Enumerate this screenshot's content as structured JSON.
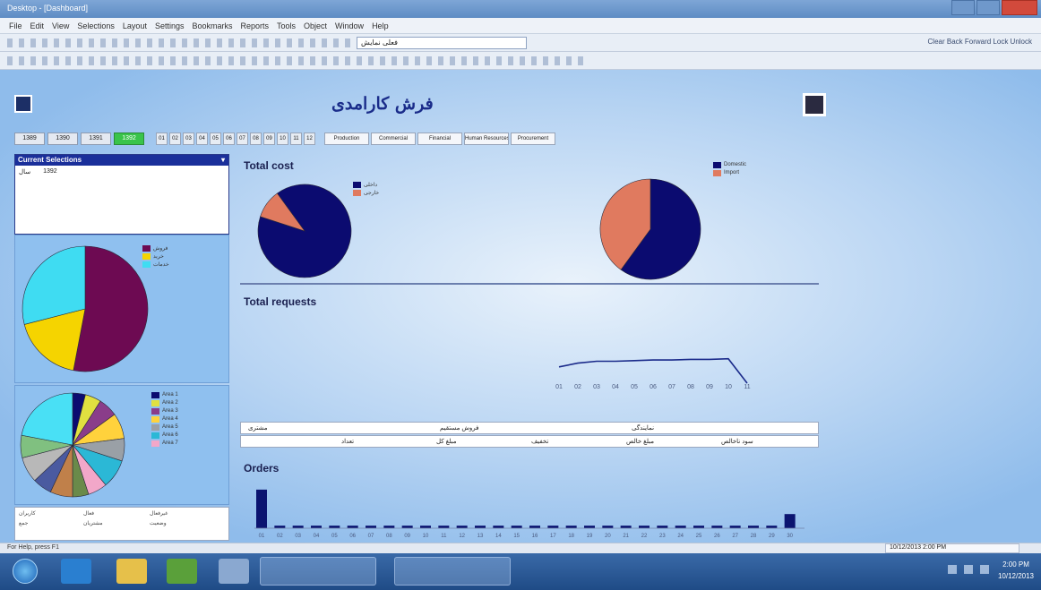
{
  "window": {
    "title": "Desktop - [Dashboard]"
  },
  "menu": [
    "File",
    "Edit",
    "View",
    "Selections",
    "Layout",
    "Settings",
    "Bookmarks",
    "Reports",
    "Tools",
    "Object",
    "Window",
    "Help"
  ],
  "toolbar": {
    "combo_value": "فعلی نمایش",
    "right_items": "Clear  Back  Forward  Lock  Unlock"
  },
  "header": {
    "title": "فرش کارامدی"
  },
  "filters": {
    "years": [
      {
        "label": "1389",
        "active": false
      },
      {
        "label": "1390",
        "active": false
      },
      {
        "label": "1391",
        "active": false
      },
      {
        "label": "1392",
        "active": true
      }
    ],
    "months": [
      "01",
      "02",
      "03",
      "04",
      "05",
      "06",
      "07",
      "08",
      "09",
      "10",
      "11",
      "12"
    ],
    "units": [
      "Production",
      "Commercial",
      "Financial",
      "Human Resources",
      "Procurement"
    ]
  },
  "current_selections": {
    "header": "Current Selections",
    "field": "سال",
    "value": "1392"
  },
  "left_legend_1": [
    {
      "label": "فروش",
      "color": "#6d0a52"
    },
    {
      "label": "خرید",
      "color": "#f5d400"
    },
    {
      "label": "خدمات",
      "color": "#3fdcf2"
    }
  ],
  "left_legend_2": [
    {
      "label": "Area 1",
      "color": "#0b0b70"
    },
    {
      "label": "Area 2",
      "color": "#e0e040"
    },
    {
      "label": "Area 3",
      "color": "#8a3d8a"
    },
    {
      "label": "Area 4",
      "color": "#ffd23c"
    },
    {
      "label": "Area 5",
      "color": "#9aa0a6"
    },
    {
      "label": "Area 6",
      "color": "#2bb8d6"
    },
    {
      "label": "Area 7",
      "color": "#f2a7c9"
    }
  ],
  "bottom_box_labels": [
    "کاربران",
    "فعال",
    "غیرفعال",
    "جمع",
    "مشتریان",
    "وضعیت"
  ],
  "sections": {
    "total_cost": "Total cost",
    "total_requests": "Total requests",
    "orders": "Orders"
  },
  "cost_legend_1": [
    {
      "label": "داخلی",
      "color": "#0b0b70"
    },
    {
      "label": "خارجی",
      "color": "#e07a5f"
    }
  ],
  "cost_legend_2": [
    {
      "label": "Domestic",
      "color": "#0b0b70"
    },
    {
      "label": "Import",
      "color": "#e07a5f"
    }
  ],
  "summary_table": {
    "row1": [
      "مشتری",
      "فروش مستقیم",
      "نمایندگی"
    ],
    "row2": [
      "",
      "تعداد",
      "مبلغ کل",
      "تخفیف",
      "مبلغ خالص",
      "سود ناخالص"
    ]
  },
  "status": {
    "left": "For Help, press F1",
    "right": "10/12/2013 2:00 PM"
  },
  "taskbar": {
    "clock_time": "2:00 PM",
    "clock_date": "10/12/2013"
  },
  "chart_data": [
    {
      "type": "pie",
      "labels": [
        "فروش",
        "خرید",
        "خدمات"
      ],
      "values": [
        53,
        18,
        29
      ],
      "colors": [
        "#6d0a52",
        "#f5d400",
        "#3fdcf2"
      ]
    },
    {
      "type": "pie",
      "labels": [
        "Area 1",
        "Area 2",
        "Area 3",
        "Area 4",
        "Area 5",
        "Area 6",
        "Area 7"
      ],
      "values": [
        4,
        5,
        6,
        8,
        7,
        9,
        6,
        5,
        7,
        6,
        8,
        7,
        22
      ],
      "colors": [
        "#0b0b70",
        "#e0e040",
        "#8a3d8a",
        "#ffd23c",
        "#9aa0a6",
        "#2bb8d6",
        "#f2a7c9",
        "#6a8a4a",
        "#c0804a",
        "#4a5aa0",
        "#b8b8b8",
        "#80c080",
        "#49e0f5"
      ]
    },
    {
      "type": "pie",
      "labels": [
        "داخلی",
        "خارجی"
      ],
      "values": [
        90,
        10
      ],
      "colors": [
        "#0b0b70",
        "#e07a5f"
      ]
    },
    {
      "type": "pie",
      "labels": [
        "Domestic",
        "Import"
      ],
      "values": [
        60,
        40
      ],
      "colors": [
        "#0b0b70",
        "#e07a5f"
      ]
    },
    {
      "type": "line",
      "x": [
        "01",
        "02",
        "03",
        "04",
        "05",
        "06",
        "07",
        "08",
        "09",
        "10",
        "11"
      ],
      "values": [
        66,
        72,
        75,
        75,
        76,
        77,
        77,
        78,
        78,
        79,
        40
      ],
      "ylim": [
        0,
        100
      ]
    },
    {
      "type": "bar",
      "categories": [
        "01",
        "02",
        "03",
        "04",
        "05",
        "06",
        "07",
        "08",
        "09",
        "10",
        "11",
        "12",
        "13",
        "14",
        "15",
        "16",
        "17",
        "18",
        "19",
        "20",
        "21",
        "22",
        "23",
        "24",
        "25",
        "26",
        "27",
        "28",
        "29",
        "30"
      ],
      "values": [
        30,
        2,
        2,
        2,
        2,
        2,
        2,
        2,
        2,
        2,
        2,
        2,
        2,
        2,
        2,
        2,
        2,
        2,
        2,
        2,
        2,
        2,
        2,
        2,
        2,
        2,
        2,
        2,
        2,
        11
      ],
      "color": "#0b1470",
      "ylim": [
        0,
        32
      ]
    }
  ]
}
